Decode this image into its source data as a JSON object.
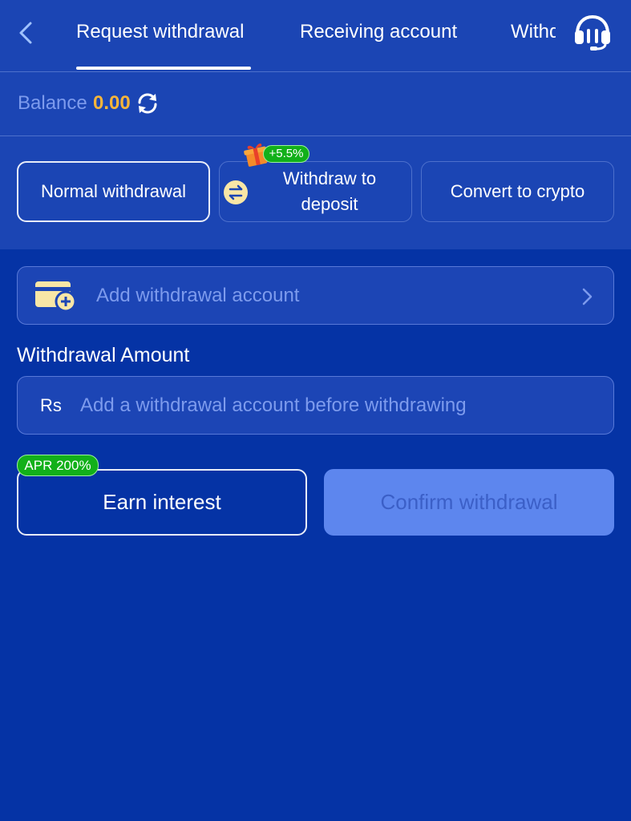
{
  "header": {
    "tabs": [
      {
        "label": "Request withdrawal",
        "active": true
      },
      {
        "label": "Receiving account",
        "active": false
      },
      {
        "label": "Withdrawal records",
        "active": false
      }
    ]
  },
  "balance": {
    "label": "Balance",
    "value": "0.00"
  },
  "options": {
    "normal_label": "Normal withdrawal",
    "deposit_line1": "Withdraw to",
    "deposit_line2": "deposit",
    "deposit_bonus": "+5.5%",
    "crypto_label": "Convert to crypto"
  },
  "account": {
    "add_label": "Add withdrawal account"
  },
  "amount": {
    "title": "Withdrawal Amount",
    "currency": "Rs",
    "placeholder": "Add a withdrawal account before withdrawing"
  },
  "actions": {
    "apr_badge": "APR 200%",
    "earn_label": "Earn interest",
    "confirm_label": "Confirm withdrawal"
  },
  "colors": {
    "page_background": "#0533a5",
    "panel_background": "#1b45b4",
    "balance_value": "#f7b53a",
    "badge_green": "#12b01a",
    "confirm_disabled": "#5d86ee"
  },
  "icons": [
    "back-arrow-icon",
    "headset-icon",
    "refresh-icon",
    "swap-icon",
    "gift-icon",
    "wallet-add-icon",
    "chevron-right-icon"
  ]
}
